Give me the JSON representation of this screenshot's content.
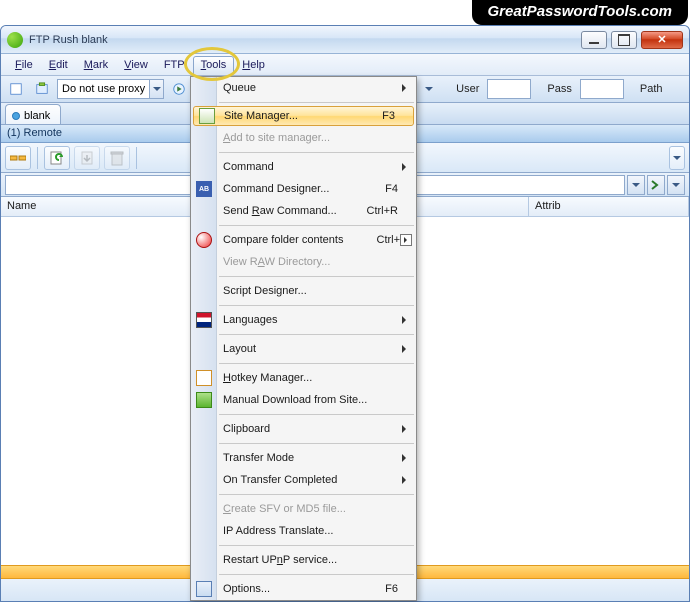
{
  "watermark": "GreatPasswordTools.com",
  "title": "FTP Rush   blank",
  "menubar": [
    {
      "label": "File",
      "u": 0
    },
    {
      "label": "Edit",
      "u": 0
    },
    {
      "label": "Mark",
      "u": 0
    },
    {
      "label": "View",
      "u": 0
    },
    {
      "label": "FTP",
      "u": -1
    },
    {
      "label": "Tools",
      "u": 0
    },
    {
      "label": "Help",
      "u": 0
    }
  ],
  "proxy": {
    "label": "Do not use proxy"
  },
  "toolbar1": {
    "user_lbl": "User",
    "pass_lbl": "Pass",
    "path_lbl": "Path"
  },
  "tabs": [
    {
      "label": "blank"
    }
  ],
  "panel_header": "(1) Remote",
  "list_headers": {
    "name": "Name",
    "attrib": "Attrib"
  },
  "menu": {
    "queue": "Queue",
    "site_manager": "Site Manager...",
    "site_manager_sc": "F3",
    "add_site": "Add to site manager...",
    "command": "Command",
    "cmd_designer": "Command Designer...",
    "cmd_designer_sc": "F4",
    "send_raw": "Send Raw Command...",
    "send_raw_sc": "Ctrl+R",
    "compare": "Compare folder contents",
    "compare_sc": "Ctrl+D",
    "view_raw": "View RAW Directory...",
    "script": "Script Designer...",
    "languages": "Languages",
    "layout": "Layout",
    "hotkey": "Hotkey Manager...",
    "manual_dl": "Manual Download from Site...",
    "clipboard": "Clipboard",
    "transfer_mode": "Transfer Mode",
    "on_complete": "On Transfer Completed",
    "create_sfv": "Create SFV or MD5 file...",
    "ip_trans": "IP Address Translate...",
    "restart_upnp": "Restart UPnP service...",
    "options": "Options...",
    "options_sc": "F6"
  }
}
